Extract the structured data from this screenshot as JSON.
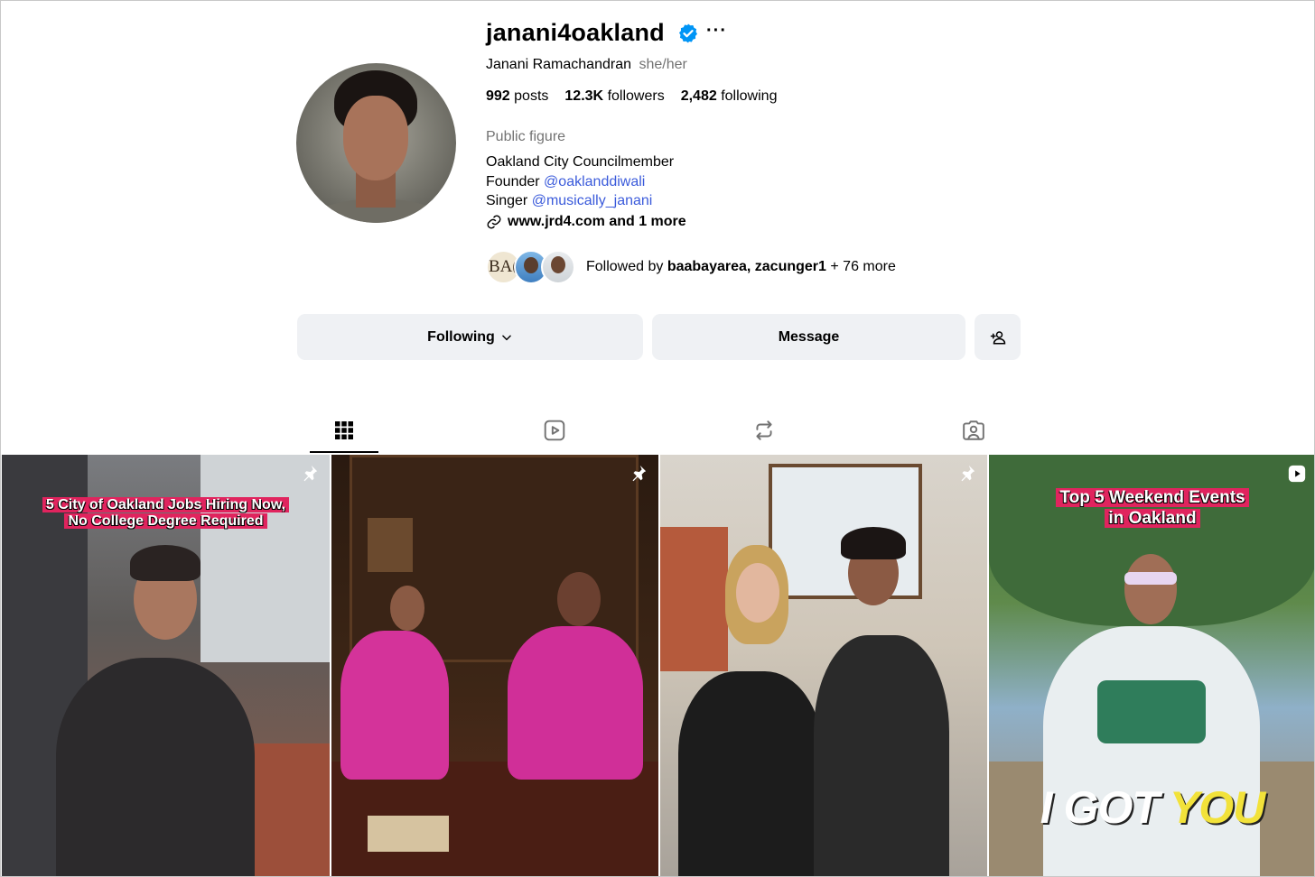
{
  "profile": {
    "username": "janani4oakland",
    "more_label": "···",
    "full_name": "Janani Ramachandran",
    "pronouns": "she/her",
    "stats": {
      "posts_count": "992",
      "posts_label": "posts",
      "followers_count": "12.3K",
      "followers_label": "followers",
      "following_count": "2,482",
      "following_label": "following"
    },
    "category": "Public figure",
    "bio": {
      "line1": "Oakland City Councilmember",
      "line2_prefix": "Founder",
      "line2_mention": "@oaklanddiwali",
      "line3_prefix": "Singer",
      "line3_mention": "@musically_janani"
    },
    "link_text": "www.jrd4.com and 1 more",
    "followed_by": {
      "prefix": "Followed by",
      "names": "baabayarea, zacunger1",
      "suffix": "+ 76 more",
      "avatar1_text": "BA("
    }
  },
  "actions": {
    "following_label": "Following",
    "message_label": "Message"
  },
  "tabs": [
    {
      "name": "posts",
      "icon": "grid-icon",
      "active": true
    },
    {
      "name": "reels",
      "icon": "reels-icon",
      "active": false
    },
    {
      "name": "reposts",
      "icon": "repost-icon",
      "active": false
    },
    {
      "name": "tagged",
      "icon": "tagged-icon",
      "active": false
    }
  ],
  "posts": [
    {
      "caption_line1": "5 City of Oakland Jobs Hiring Now,",
      "caption_line2": "No College Degree Required",
      "badge": "pin-icon"
    },
    {
      "badge": "pin-icon"
    },
    {
      "badge": "pin-icon"
    },
    {
      "caption_line1": "Top 5 Weekend Events",
      "caption_line2": "in Oakland",
      "overlay_white": "I GOT ",
      "overlay_yellow": "YOU",
      "badge": "reel-icon"
    }
  ],
  "colors": {
    "verified_blue": "#0095f6",
    "mention_blue": "#3b5bdb",
    "button_bg": "#eff1f4",
    "muted_text": "#737373",
    "caption_pink": "#e0245e"
  }
}
